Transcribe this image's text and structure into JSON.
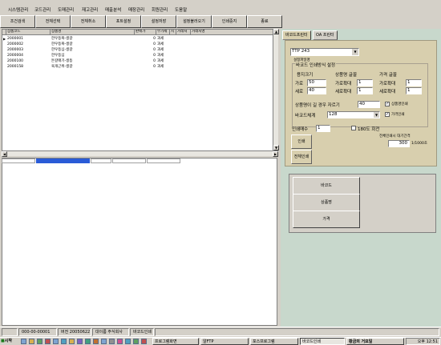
{
  "menu": [
    "시스템관리",
    "코드관리",
    "도매관리",
    "재고관리",
    "매출분석",
    "매장관리",
    "회원관리",
    "도움말"
  ],
  "toolbar": [
    "조건검색",
    "전체선택",
    "전체취소",
    "포트설정",
    "설정저장",
    "설정불러오기",
    "인쇄중지",
    "종료"
  ],
  "grid": {
    "columns": [
      "상품코드",
      "상품명",
      "판매가",
      "부가세",
      "지",
      "거래처",
      "거래처명"
    ],
    "rows": [
      {
        "code": "2000001",
        "name": "한우등복-생갈",
        "price": "0",
        "tax": "과세"
      },
      {
        "code": "2000002",
        "name": "한우등복-생갈",
        "price": "0",
        "tax": "과세"
      },
      {
        "code": "2000003",
        "name": "한우등심-생갈",
        "price": "0",
        "tax": "과세"
      },
      {
        "code": "2000004",
        "name": "한우등심",
        "price": "0",
        "tax": "과세"
      },
      {
        "code": "2000100",
        "name": "돈갈매기-생등",
        "price": "0",
        "tax": "과세"
      },
      {
        "code": "2000158",
        "name": "육개근위-생갈",
        "price": "0",
        "tax": "과세"
      }
    ]
  },
  "right_tabs": [
    "바코드프린터",
    "OA 프린터"
  ],
  "printer": {
    "model": "TTP 243",
    "settings_label": "설정파일명",
    "group_title": "바코드 인쇄방식 설정",
    "paper_title": "용지크기",
    "width_label": "가로",
    "width_value": "50",
    "height_label": "세로",
    "height_value": "40",
    "name_font_title": "상품명 글꼴",
    "price_font_title": "가격 글꼴",
    "hzoom_label": "가로확대",
    "vzoom_label": "세로확대",
    "name_hzoom": "1",
    "name_vzoom": "1",
    "price_hzoom": "1",
    "price_vzoom": "1",
    "cut_label": "상품명이 길 경우 자르기",
    "cut_value": "40",
    "print_name_label": "상품명인쇄",
    "print_price_label": "가격인쇄",
    "barcode_system_label": "바코드체계",
    "barcode_system_value": "128",
    "copies_label": "인쇄매수",
    "copies_value": "1",
    "rotate_label": "180도 회전",
    "interval_label": "전체인쇄시 대기간격",
    "interval_value": "300",
    "interval_unit": "1/1000초",
    "print_button": "인쇄",
    "print_all_button": "전체인쇄"
  },
  "print_items": [
    "바코드",
    "상품명",
    "가격"
  ],
  "status": [
    "000-00-00001",
    "버전 20050622",
    "대이름 주식회사",
    "바코드인쇄"
  ],
  "taskbar": {
    "start": "시작",
    "items": [
      "프로그램화면",
      "알FTP",
      "포스프로그램",
      "바코드인쇄",
      "황금의 거요일"
    ],
    "clock": "오후 12:51"
  }
}
